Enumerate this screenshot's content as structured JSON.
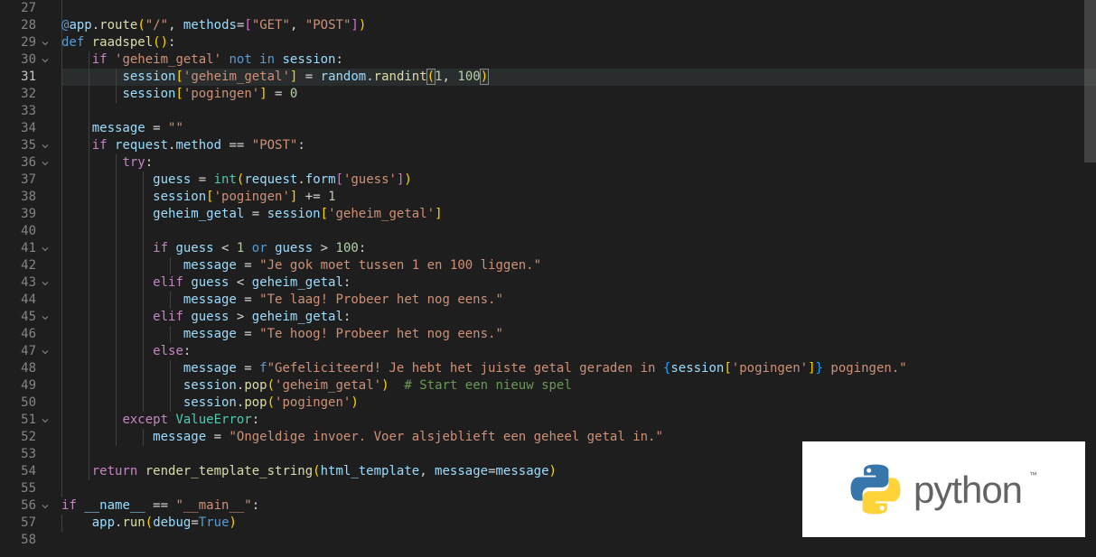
{
  "editor": {
    "language": "python",
    "first_line_no": 27,
    "active_line_no": 31,
    "lines": [
      {
        "no": 27,
        "fold": false,
        "guides": [
          0
        ],
        "tokens": []
      },
      {
        "no": 28,
        "fold": false,
        "guides": [
          0
        ],
        "tokens": [
          [
            "indent",
            ""
          ],
          [
            "at",
            "@"
          ],
          [
            "var",
            "app"
          ],
          [
            "punc",
            "."
          ],
          [
            "fn",
            "route"
          ],
          [
            "b1",
            "("
          ],
          [
            "str",
            "\"/\""
          ],
          [
            "punc",
            ", "
          ],
          [
            "var",
            "methods"
          ],
          [
            "op",
            "="
          ],
          [
            "b2",
            "["
          ],
          [
            "str",
            "\"GET\""
          ],
          [
            "punc",
            ", "
          ],
          [
            "str",
            "\"POST\""
          ],
          [
            "b2",
            "]"
          ],
          [
            "b1",
            ")"
          ]
        ]
      },
      {
        "no": 29,
        "fold": true,
        "guides": [
          0
        ],
        "tokens": [
          [
            "kw",
            "def "
          ],
          [
            "fn",
            "raadspel"
          ],
          [
            "b1",
            "()"
          ],
          [
            "punc",
            ":"
          ]
        ]
      },
      {
        "no": 30,
        "fold": true,
        "guides": [
          0,
          1
        ],
        "tokens": [
          [
            "indent",
            "    "
          ],
          [
            "kw2",
            "if "
          ],
          [
            "str",
            "'geheim_getal'"
          ],
          [
            "op",
            " "
          ],
          [
            "kw",
            "not in"
          ],
          [
            "op",
            " "
          ],
          [
            "var",
            "session"
          ],
          [
            "punc",
            ":"
          ]
        ]
      },
      {
        "no": 31,
        "fold": false,
        "guides": [
          0,
          1,
          2
        ],
        "active": true,
        "tokens": [
          [
            "indent",
            "        "
          ],
          [
            "var",
            "session"
          ],
          [
            "b1",
            "["
          ],
          [
            "str",
            "'geheim_getal'"
          ],
          [
            "b1",
            "]"
          ],
          [
            "op",
            " = "
          ],
          [
            "var",
            "random"
          ],
          [
            "punc",
            "."
          ],
          [
            "fn",
            "randint"
          ],
          [
            "b1m",
            "("
          ],
          [
            "num",
            "1"
          ],
          [
            "punc",
            ", "
          ],
          [
            "num",
            "100"
          ],
          [
            "b1m",
            ")"
          ]
        ]
      },
      {
        "no": 32,
        "fold": false,
        "guides": [
          0,
          1,
          2
        ],
        "tokens": [
          [
            "indent",
            "        "
          ],
          [
            "var",
            "session"
          ],
          [
            "b1",
            "["
          ],
          [
            "str",
            "'pogingen'"
          ],
          [
            "b1",
            "]"
          ],
          [
            "op",
            " = "
          ],
          [
            "num",
            "0"
          ]
        ]
      },
      {
        "no": 33,
        "fold": false,
        "guides": [
          0,
          1
        ],
        "tokens": []
      },
      {
        "no": 34,
        "fold": false,
        "guides": [
          0,
          1
        ],
        "tokens": [
          [
            "indent",
            "    "
          ],
          [
            "var",
            "message"
          ],
          [
            "op",
            " = "
          ],
          [
            "str",
            "\"\""
          ]
        ]
      },
      {
        "no": 35,
        "fold": true,
        "guides": [
          0,
          1
        ],
        "tokens": [
          [
            "indent",
            "    "
          ],
          [
            "kw2",
            "if "
          ],
          [
            "var",
            "request"
          ],
          [
            "punc",
            "."
          ],
          [
            "var",
            "method"
          ],
          [
            "op",
            " == "
          ],
          [
            "str",
            "\"POST\""
          ],
          [
            "punc",
            ":"
          ]
        ]
      },
      {
        "no": 36,
        "fold": true,
        "guides": [
          0,
          1,
          2
        ],
        "tokens": [
          [
            "indent",
            "        "
          ],
          [
            "kw2",
            "try"
          ],
          [
            "punc",
            ":"
          ]
        ]
      },
      {
        "no": 37,
        "fold": false,
        "guides": [
          0,
          1,
          2,
          3
        ],
        "tokens": [
          [
            "indent",
            "            "
          ],
          [
            "var",
            "guess"
          ],
          [
            "op",
            " = "
          ],
          [
            "builtin",
            "int"
          ],
          [
            "b1",
            "("
          ],
          [
            "var",
            "request"
          ],
          [
            "punc",
            "."
          ],
          [
            "var",
            "form"
          ],
          [
            "b2",
            "["
          ],
          [
            "str",
            "'guess'"
          ],
          [
            "b2",
            "]"
          ],
          [
            "b1",
            ")"
          ]
        ]
      },
      {
        "no": 38,
        "fold": false,
        "guides": [
          0,
          1,
          2,
          3
        ],
        "tokens": [
          [
            "indent",
            "            "
          ],
          [
            "var",
            "session"
          ],
          [
            "b1",
            "["
          ],
          [
            "str",
            "'pogingen'"
          ],
          [
            "b1",
            "]"
          ],
          [
            "op",
            " += "
          ],
          [
            "num",
            "1"
          ]
        ]
      },
      {
        "no": 39,
        "fold": false,
        "guides": [
          0,
          1,
          2,
          3
        ],
        "tokens": [
          [
            "indent",
            "            "
          ],
          [
            "var",
            "geheim_getal"
          ],
          [
            "op",
            " = "
          ],
          [
            "var",
            "session"
          ],
          [
            "b1",
            "["
          ],
          [
            "str",
            "'geheim_getal'"
          ],
          [
            "b1",
            "]"
          ]
        ]
      },
      {
        "no": 40,
        "fold": false,
        "guides": [
          0,
          1,
          2,
          3
        ],
        "tokens": []
      },
      {
        "no": 41,
        "fold": true,
        "guides": [
          0,
          1,
          2,
          3
        ],
        "tokens": [
          [
            "indent",
            "            "
          ],
          [
            "kw2",
            "if "
          ],
          [
            "var",
            "guess"
          ],
          [
            "op",
            " < "
          ],
          [
            "num",
            "1"
          ],
          [
            "op",
            " "
          ],
          [
            "kw",
            "or"
          ],
          [
            "op",
            " "
          ],
          [
            "var",
            "guess"
          ],
          [
            "op",
            " > "
          ],
          [
            "num",
            "100"
          ],
          [
            "punc",
            ":"
          ]
        ]
      },
      {
        "no": 42,
        "fold": false,
        "guides": [
          0,
          1,
          2,
          3,
          4
        ],
        "tokens": [
          [
            "indent",
            "                "
          ],
          [
            "var",
            "message"
          ],
          [
            "op",
            " = "
          ],
          [
            "str",
            "\"Je gok moet tussen 1 en 100 liggen.\""
          ]
        ]
      },
      {
        "no": 43,
        "fold": true,
        "guides": [
          0,
          1,
          2,
          3
        ],
        "tokens": [
          [
            "indent",
            "            "
          ],
          [
            "kw2",
            "elif "
          ],
          [
            "var",
            "guess"
          ],
          [
            "op",
            " < "
          ],
          [
            "var",
            "geheim_getal"
          ],
          [
            "punc",
            ":"
          ]
        ]
      },
      {
        "no": 44,
        "fold": false,
        "guides": [
          0,
          1,
          2,
          3,
          4
        ],
        "tokens": [
          [
            "indent",
            "                "
          ],
          [
            "var",
            "message"
          ],
          [
            "op",
            " = "
          ],
          [
            "str",
            "\"Te laag! Probeer het nog eens.\""
          ]
        ]
      },
      {
        "no": 45,
        "fold": true,
        "guides": [
          0,
          1,
          2,
          3
        ],
        "tokens": [
          [
            "indent",
            "            "
          ],
          [
            "kw2",
            "elif "
          ],
          [
            "var",
            "guess"
          ],
          [
            "op",
            " > "
          ],
          [
            "var",
            "geheim_getal"
          ],
          [
            "punc",
            ":"
          ]
        ]
      },
      {
        "no": 46,
        "fold": false,
        "guides": [
          0,
          1,
          2,
          3,
          4
        ],
        "tokens": [
          [
            "indent",
            "                "
          ],
          [
            "var",
            "message"
          ],
          [
            "op",
            " = "
          ],
          [
            "str",
            "\"Te hoog! Probeer het nog eens.\""
          ]
        ]
      },
      {
        "no": 47,
        "fold": true,
        "guides": [
          0,
          1,
          2,
          3
        ],
        "tokens": [
          [
            "indent",
            "            "
          ],
          [
            "kw2",
            "else"
          ],
          [
            "punc",
            ":"
          ]
        ]
      },
      {
        "no": 48,
        "fold": false,
        "guides": [
          0,
          1,
          2,
          3,
          4
        ],
        "tokens": [
          [
            "indent",
            "                "
          ],
          [
            "var",
            "message"
          ],
          [
            "op",
            " = "
          ],
          [
            "kw",
            "f"
          ],
          [
            "str",
            "\"Gefeliciteerd! Je hebt het juiste getal geraden in "
          ],
          [
            "b3",
            "{"
          ],
          [
            "var",
            "session"
          ],
          [
            "b1",
            "["
          ],
          [
            "str",
            "'pogingen'"
          ],
          [
            "b1",
            "]"
          ],
          [
            "b3",
            "}"
          ],
          [
            "str",
            " pogingen.\""
          ]
        ]
      },
      {
        "no": 49,
        "fold": false,
        "guides": [
          0,
          1,
          2,
          3,
          4
        ],
        "tokens": [
          [
            "indent",
            "                "
          ],
          [
            "var",
            "session"
          ],
          [
            "punc",
            "."
          ],
          [
            "fn",
            "pop"
          ],
          [
            "b1",
            "("
          ],
          [
            "str",
            "'geheim_getal'"
          ],
          [
            "b1",
            ")"
          ],
          [
            "plain",
            "  "
          ],
          [
            "cmt",
            "# Start een nieuw spel"
          ]
        ]
      },
      {
        "no": 50,
        "fold": false,
        "guides": [
          0,
          1,
          2,
          3,
          4
        ],
        "tokens": [
          [
            "indent",
            "                "
          ],
          [
            "var",
            "session"
          ],
          [
            "punc",
            "."
          ],
          [
            "fn",
            "pop"
          ],
          [
            "b1",
            "("
          ],
          [
            "str",
            "'pogingen'"
          ],
          [
            "b1",
            ")"
          ]
        ]
      },
      {
        "no": 51,
        "fold": true,
        "guides": [
          0,
          1,
          2
        ],
        "tokens": [
          [
            "indent",
            "        "
          ],
          [
            "kw2",
            "except "
          ],
          [
            "cls",
            "ValueError"
          ],
          [
            "punc",
            ":"
          ]
        ]
      },
      {
        "no": 52,
        "fold": false,
        "guides": [
          0,
          1,
          2,
          3
        ],
        "tokens": [
          [
            "indent",
            "            "
          ],
          [
            "var",
            "message"
          ],
          [
            "op",
            " = "
          ],
          [
            "str",
            "\"Ongeldige invoer. Voer alsjeblieft een geheel getal in.\""
          ]
        ]
      },
      {
        "no": 53,
        "fold": false,
        "guides": [
          0,
          1
        ],
        "tokens": []
      },
      {
        "no": 54,
        "fold": false,
        "guides": [
          0,
          1
        ],
        "tokens": [
          [
            "indent",
            "    "
          ],
          [
            "kw2",
            "return "
          ],
          [
            "fn",
            "render_template_string"
          ],
          [
            "b1",
            "("
          ],
          [
            "var",
            "html_template"
          ],
          [
            "punc",
            ", "
          ],
          [
            "var",
            "message"
          ],
          [
            "op",
            "="
          ],
          [
            "var",
            "message"
          ],
          [
            "b1",
            ")"
          ]
        ]
      },
      {
        "no": 55,
        "fold": false,
        "guides": [
          0
        ],
        "tokens": []
      },
      {
        "no": 56,
        "fold": true,
        "guides": [],
        "tokens": [
          [
            "kw2",
            "if "
          ],
          [
            "var",
            "__name__"
          ],
          [
            "op",
            " == "
          ],
          [
            "str",
            "\"__main__\""
          ],
          [
            "punc",
            ":"
          ]
        ]
      },
      {
        "no": 57,
        "fold": false,
        "guides": [
          0
        ],
        "tokens": [
          [
            "indent",
            "    "
          ],
          [
            "var",
            "app"
          ],
          [
            "punc",
            "."
          ],
          [
            "fn",
            "run"
          ],
          [
            "b1",
            "("
          ],
          [
            "var",
            "debug"
          ],
          [
            "op",
            "="
          ],
          [
            "const",
            "True"
          ],
          [
            "b1",
            ")"
          ]
        ]
      },
      {
        "no": 58,
        "fold": false,
        "guides": [],
        "tokens": []
      }
    ]
  },
  "logo": {
    "word": "python",
    "tm": "™"
  }
}
